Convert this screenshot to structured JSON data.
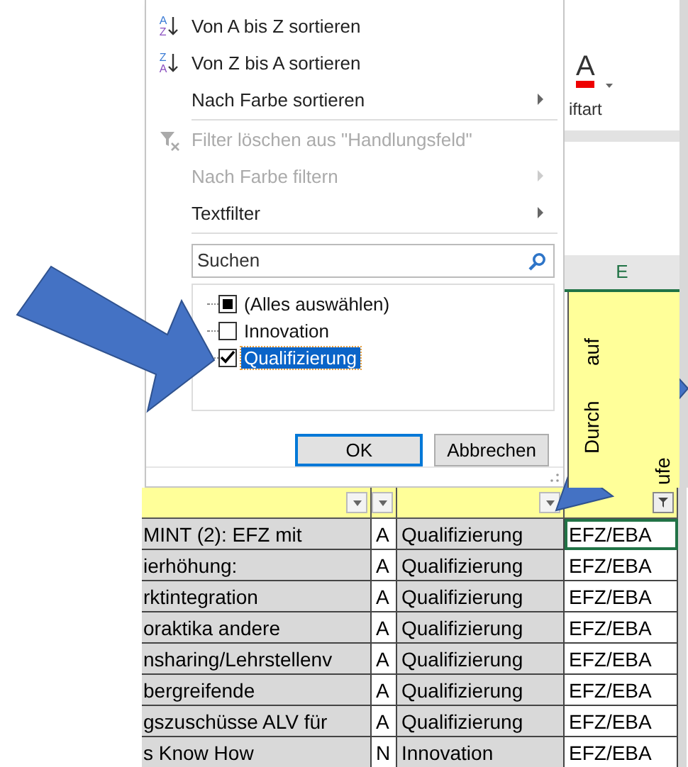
{
  "filter_menu": {
    "items": [
      {
        "label": "Von A bis Z sortieren",
        "kind": "sort",
        "icon_text": [
          "A",
          "Z"
        ],
        "disabled": false,
        "submenu": false,
        "separator_after": false
      },
      {
        "label": "Von Z bis A sortieren",
        "kind": "sort",
        "icon_text": [
          "Z",
          "A"
        ],
        "disabled": false,
        "submenu": false,
        "separator_after": false
      },
      {
        "label": "Nach Farbe sortieren",
        "kind": "plain",
        "disabled": false,
        "submenu": true,
        "separator_after": true
      },
      {
        "label": "Filter löschen aus \"Handlungsfeld\"",
        "kind": "clear",
        "disabled": true,
        "submenu": false,
        "separator_after": false
      },
      {
        "label": "Nach Farbe filtern",
        "kind": "plain",
        "disabled": true,
        "submenu": true,
        "separator_after": false
      },
      {
        "label": "Textfilter",
        "kind": "plain",
        "disabled": false,
        "submenu": true,
        "separator_after": true
      }
    ],
    "search": {
      "placeholder": "Suchen"
    },
    "values": [
      {
        "label": "(Alles auswählen)",
        "checked": false,
        "partial": true,
        "selected": false
      },
      {
        "label": "Innovation",
        "checked": false,
        "partial": false,
        "selected": false
      },
      {
        "label": "Qualifizierung",
        "checked": true,
        "selected": true
      }
    ],
    "buttons": [
      {
        "label": "OK",
        "focused": true
      },
      {
        "label": "Abbrechen",
        "focused": false
      }
    ]
  },
  "ribbon": {
    "font_color_letter": "A",
    "group_label": "iftart"
  },
  "sheet": {
    "column_header": "E",
    "header_cells": [
      {
        "filtered": false
      },
      {
        "filtered": false
      },
      {
        "filtered": false
      },
      {
        "filtered": true,
        "text_parts": [
          "Durch",
          "auf",
          "ufe"
        ]
      }
    ],
    "rows": [
      {
        "cells": [
          "MINT (2): EFZ mit",
          "A",
          "Qualifizierung",
          "EFZ/EBA"
        ],
        "selected": true
      },
      {
        "cells": [
          "ierhöhung:",
          "A",
          "Qualifizierung",
          "EFZ/EBA"
        ],
        "selected": false
      },
      {
        "cells": [
          "rktintegration",
          "A",
          "Qualifizierung",
          "EFZ/EBA"
        ],
        "selected": false
      },
      {
        "cells": [
          "oraktika andere",
          "A",
          "Qualifizierung",
          "EFZ/EBA"
        ],
        "selected": false
      },
      {
        "cells": [
          "nsharing/Lehrstellenv",
          "A",
          "Qualifizierung",
          "EFZ/EBA"
        ],
        "selected": false
      },
      {
        "cells": [
          "bergreifende",
          "A",
          "Qualifizierung",
          "EFZ/EBA"
        ],
        "selected": false
      },
      {
        "cells": [
          "gszuschüsse ALV für",
          "A",
          "Qualifizierung",
          "EFZ/EBA"
        ],
        "selected": false
      },
      {
        "cells": [
          "s Know How",
          "N",
          "Innovation",
          "EFZ/EBA"
        ],
        "selected": false
      }
    ]
  }
}
